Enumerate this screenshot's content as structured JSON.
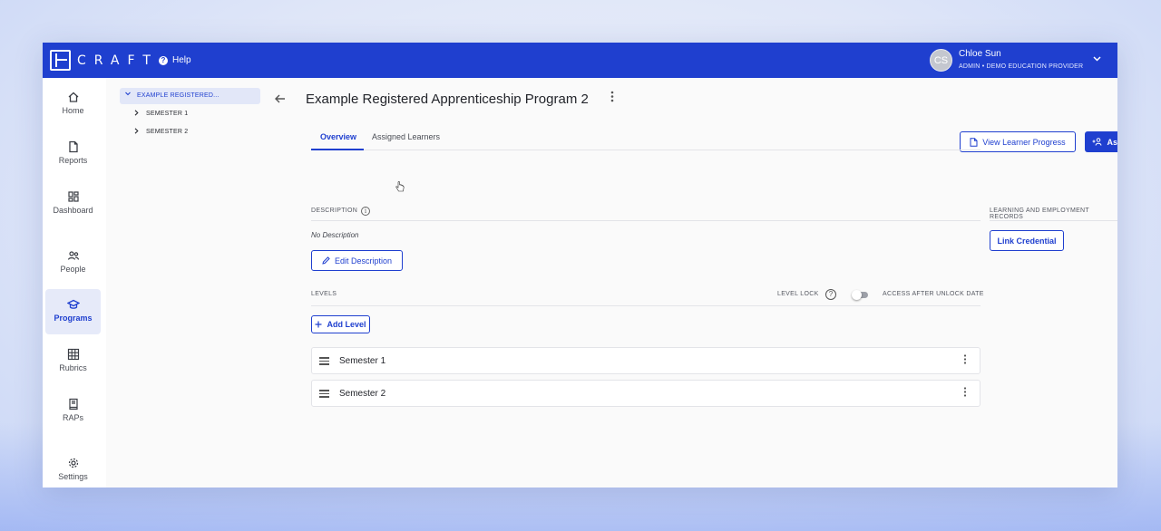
{
  "app": {
    "logo_text": "CRAFT",
    "help_label": "Help",
    "user": {
      "initials": "CS",
      "name": "Chloe Sun",
      "role": "ADMIN • DEMO EDUCATION PROVIDER"
    }
  },
  "colors": {
    "brand": "#1f3fcf",
    "nav_active_bg": "#e6eaf9"
  },
  "nav": {
    "items": [
      {
        "label": "Home",
        "icon": "home-icon"
      },
      {
        "label": "Reports",
        "icon": "file-icon"
      },
      {
        "label": "Dashboard",
        "icon": "grid-icon"
      },
      {
        "label": "People",
        "icon": "people-icon"
      },
      {
        "label": "Programs",
        "icon": "graduation-cap-icon",
        "active": true
      },
      {
        "label": "Rubrics",
        "icon": "table-icon"
      },
      {
        "label": "RAPs",
        "icon": "book-icon"
      },
      {
        "label": "Settings",
        "icon": "gear-icon"
      }
    ]
  },
  "tree": {
    "root": "EXAMPLE REGISTERED...",
    "children": [
      "SEMESTER 1",
      "SEMESTER 2"
    ]
  },
  "page": {
    "title": "Example Registered Apprenticeship Program 2",
    "view_progress_label": "View Learner Progress",
    "assign_label": "Assign",
    "tabs": [
      "Overview",
      "Assigned Learners"
    ],
    "active_tab": "Overview"
  },
  "description": {
    "label": "DESCRIPTION",
    "value": "No Description",
    "edit_label": "Edit Description"
  },
  "records": {
    "label": "LEARNING AND EMPLOYMENT RECORDS",
    "link_label": "Link Credential"
  },
  "levels": {
    "label": "LEVELS",
    "lock_label": "LEVEL LOCK",
    "access_label": "ACCESS AFTER UNLOCK DATE",
    "access_enabled": false,
    "add_label": "Add Level",
    "items": [
      "Semester 1",
      "Semester 2"
    ]
  }
}
